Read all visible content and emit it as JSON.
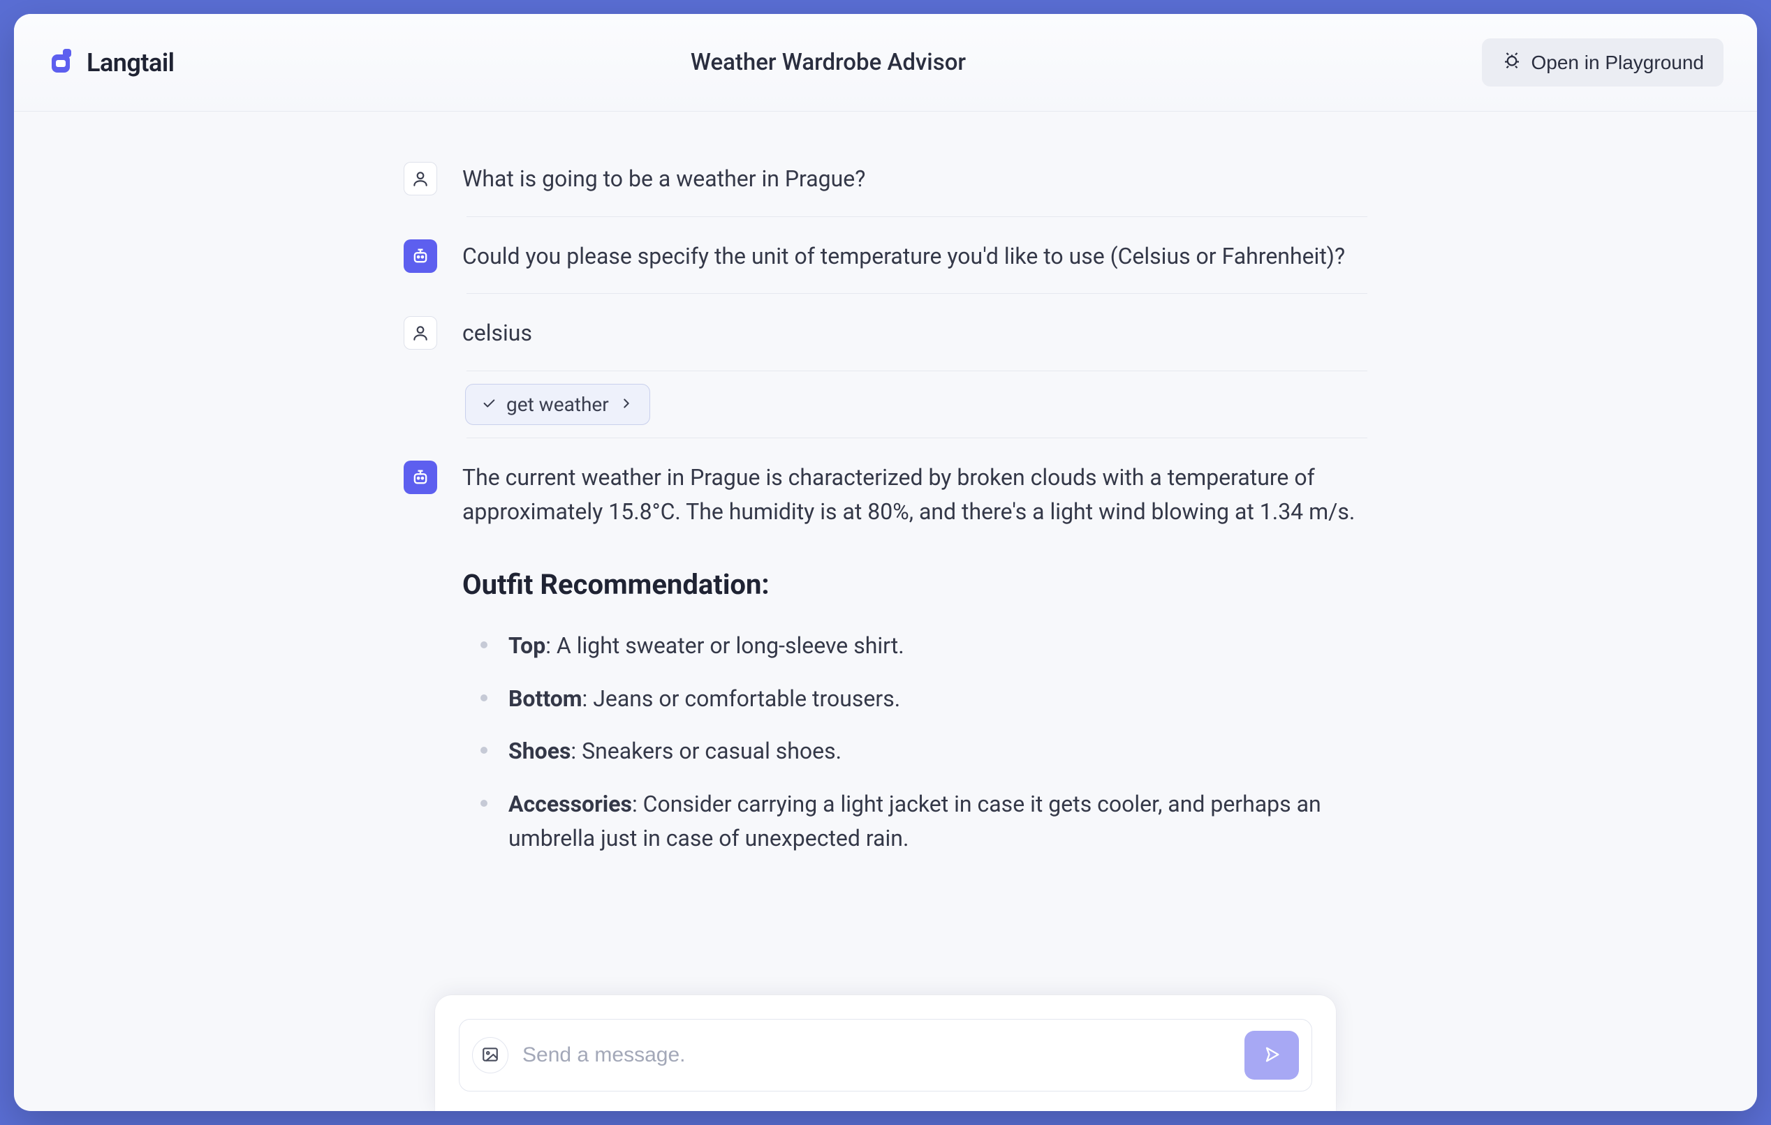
{
  "header": {
    "brand": "Langtail",
    "title": "Weather Wardrobe Advisor",
    "open_label": "Open in Playground"
  },
  "messages": {
    "m0": "What is going to be a weather in Prague?",
    "m1": "Could you please specify the unit of temperature you'd like to use (Celsius or Fahrenheit)?",
    "m2": "celsius",
    "tool_label": "get weather",
    "m3_intro": "The current weather in Prague is characterized by broken clouds with a temperature of approximately 15.8°C. The humidity is at 80%, and there's a light wind blowing at 1.34 m/s.",
    "rec_heading": "Outfit Recommendation:",
    "rec": [
      {
        "k": "Top",
        "v": ": A light sweater or long-sleeve shirt."
      },
      {
        "k": "Bottom",
        "v": ": Jeans or comfortable trousers."
      },
      {
        "k": "Shoes",
        "v": ": Sneakers or casual shoes."
      },
      {
        "k": "Accessories",
        "v": ": Consider carrying a light jacket in case it gets cooler, and perhaps an umbrella just in case of unexpected rain."
      }
    ]
  },
  "composer": {
    "placeholder": "Send a message."
  }
}
